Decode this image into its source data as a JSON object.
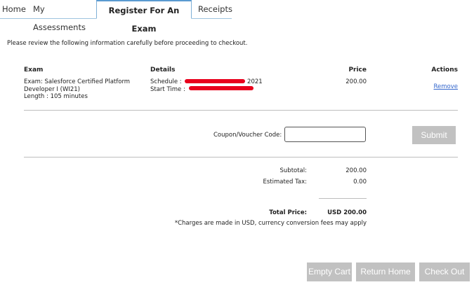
{
  "tabs": [
    {
      "label": "Home",
      "active": false
    },
    {
      "label": "My Assessments",
      "active": false
    },
    {
      "label": "Register For An Exam",
      "active": true
    },
    {
      "label": "Receipts",
      "active": false
    }
  ],
  "intro": "Please review the following information carefully before proceeding to checkout.",
  "table": {
    "headers": {
      "exam": "Exam",
      "details": "Details",
      "price": "Price",
      "actions": "Actions"
    },
    "row": {
      "exam_line1": "Exam: Salesforce Certified Platform",
      "exam_line2": "Developer I (WI21)",
      "exam_line3": "Length : 105 minutes",
      "schedule_label": "Schedule  :",
      "schedule_year": "2021",
      "start_label": "Start Time  :",
      "price": "200.00",
      "action": "Remove"
    }
  },
  "coupon": {
    "label": "Coupon/Voucher Code:",
    "value": "",
    "submit_label": "Submit"
  },
  "summary": {
    "subtotal_label": "Subtotal:",
    "subtotal_value": "200.00",
    "tax_label": "Estimated Tax:",
    "tax_value": "0.00",
    "total_label": "Total Price:",
    "total_value": "USD 200.00",
    "note": "*Charges are made in USD, currency conversion fees may apply"
  },
  "buttons": {
    "empty_cart": "Empty Cart",
    "return_home": "Return Home",
    "check_out": "Check Out"
  },
  "colors": {
    "button_bg": "#c1c1c1",
    "tab_border": "#7fb0d6",
    "link": "#3366cc",
    "redaction": "#e8001c"
  }
}
